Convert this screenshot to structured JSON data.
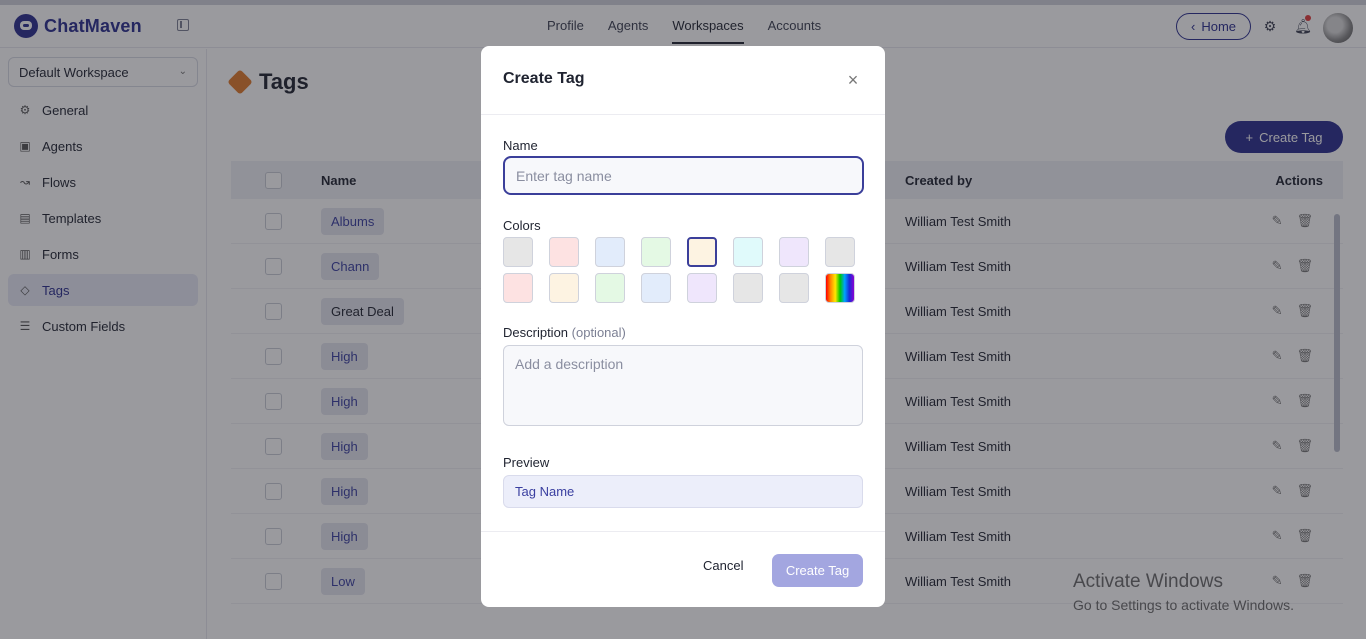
{
  "app": {
    "brand": "ChatMaven"
  },
  "topnav": {
    "items": [
      "Profile",
      "Agents",
      "Workspaces",
      "Accounts"
    ],
    "active": "Workspaces",
    "home_label": "Home"
  },
  "sidebar": {
    "workspace": "Default Workspace",
    "items": [
      {
        "label": "General",
        "icon": "gear-icon"
      },
      {
        "label": "Agents",
        "icon": "bot-icon"
      },
      {
        "label": "Flows",
        "icon": "flow-icon"
      },
      {
        "label": "Templates",
        "icon": "template-icon"
      },
      {
        "label": "Forms",
        "icon": "form-icon"
      },
      {
        "label": "Tags",
        "icon": "tag-icon",
        "active": true
      },
      {
        "label": "Custom Fields",
        "icon": "list-icon"
      }
    ]
  },
  "page": {
    "title": "Tags",
    "create_button": "Create Tag",
    "table": {
      "headers": {
        "name": "Name",
        "created_by": "Created by",
        "actions": "Actions"
      },
      "rows": [
        {
          "name": "Albums",
          "created_by": "William Test Smith"
        },
        {
          "name": "Chann",
          "created_by": "William Test Smith"
        },
        {
          "name": "Great Deal",
          "created_by": "William Test Smith",
          "plain": true
        },
        {
          "name": "High",
          "created_by": "William Test Smith"
        },
        {
          "name": "High",
          "created_by": "William Test Smith"
        },
        {
          "name": "High",
          "created_by": "William Test Smith"
        },
        {
          "name": "High",
          "created_by": "William Test Smith"
        },
        {
          "name": "High",
          "created_by": "William Test Smith"
        },
        {
          "name": "Low",
          "created_by": "William Test Smith"
        }
      ]
    }
  },
  "watermark": {
    "line1": "Activate Windows",
    "line2": "Go to Settings to activate Windows."
  },
  "modal": {
    "title": "Create Tag",
    "name_label": "Name",
    "name_placeholder": "Enter tag name",
    "colors_label": "Colors",
    "colors": [
      "#e6e6e6",
      "#fde2e2",
      "#e2ecfb",
      "#e4f9e4",
      "#fdf3e2",
      "#e0fafb",
      "#efe6fc",
      "#e6e6e6",
      "#fde2e2",
      "#fdf3e2",
      "#e4f9e4",
      "#e2ecfb",
      "#efe6fc",
      "#e6e6e6",
      "#e6e6e6",
      "rainbow"
    ],
    "selected_color_index": 4,
    "description_label": "Description",
    "description_optional": "(optional)",
    "description_placeholder": "Add a description",
    "preview_label": "Preview",
    "preview_text": "Tag Name",
    "cancel_label": "Cancel",
    "submit_label": "Create Tag"
  }
}
